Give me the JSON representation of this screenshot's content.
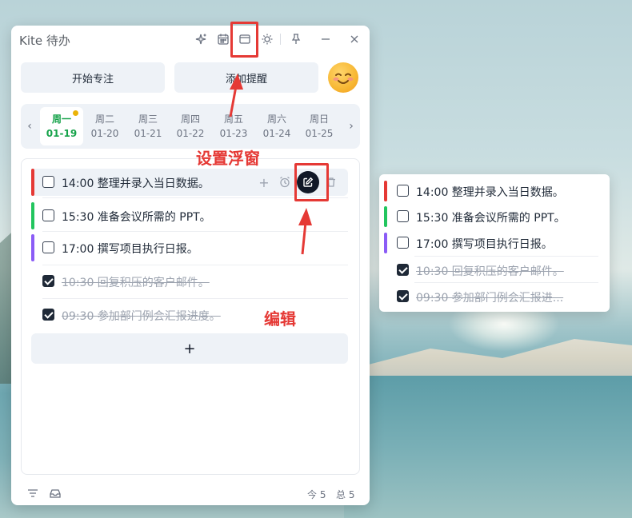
{
  "window": {
    "title": "Kite 待办",
    "icons": [
      "sparkle-icon",
      "calendar-icon",
      "float-window-icon",
      "theme-icon",
      "pin-icon",
      "minimize-icon",
      "close-icon"
    ]
  },
  "toolbar": {
    "focus_label": "开始专注",
    "reminder_label": "添加提醒",
    "emoji": "😊"
  },
  "week": {
    "days": [
      {
        "name": "周一",
        "date": "01-19",
        "active": true,
        "has_dot": true
      },
      {
        "name": "周二",
        "date": "01-20"
      },
      {
        "name": "周三",
        "date": "01-21"
      },
      {
        "name": "周四",
        "date": "01-22"
      },
      {
        "name": "周五",
        "date": "01-23"
      },
      {
        "name": "周六",
        "date": "01-24"
      },
      {
        "name": "周日",
        "date": "01-25"
      }
    ]
  },
  "tasks": [
    {
      "text": "14:00 整理并录入当日数据。",
      "done": false,
      "color": "#e53935"
    },
    {
      "text": "15:30 准备会议所需的 PPT。",
      "done": false,
      "color": "#22c55e"
    },
    {
      "text": "17:00 撰写项目执行日报。",
      "done": false,
      "color": "#8b5cf6"
    },
    {
      "text": "10:30 回复积压的客户邮件。",
      "done": true,
      "color": null
    },
    {
      "text": "09:30 参加部门例会汇报进度。",
      "done": true,
      "color": null
    }
  ],
  "add_label": "+",
  "footer": {
    "today_count": "今 5",
    "total_count": "总 5"
  },
  "float_window": {
    "items": [
      {
        "text": "14:00 整理并录入当日数据。",
        "done": false,
        "color": "#e53935"
      },
      {
        "text": "15:30 准备会议所需的 PPT。",
        "done": false,
        "color": "#22c55e"
      },
      {
        "text": "17:00 撰写项目执行日报。",
        "done": false,
        "color": "#8b5cf6"
      },
      {
        "text": "10:30 回复积压的客户邮件。",
        "done": true,
        "color": null
      },
      {
        "text": "09:30 参加部门例会汇报进...",
        "done": true,
        "color": null
      }
    ]
  },
  "annotations": {
    "float_label": "设置浮窗",
    "edit_label": "编辑"
  },
  "colors": {
    "accent_green": "#16a34a",
    "annotation_red": "#e53935"
  }
}
